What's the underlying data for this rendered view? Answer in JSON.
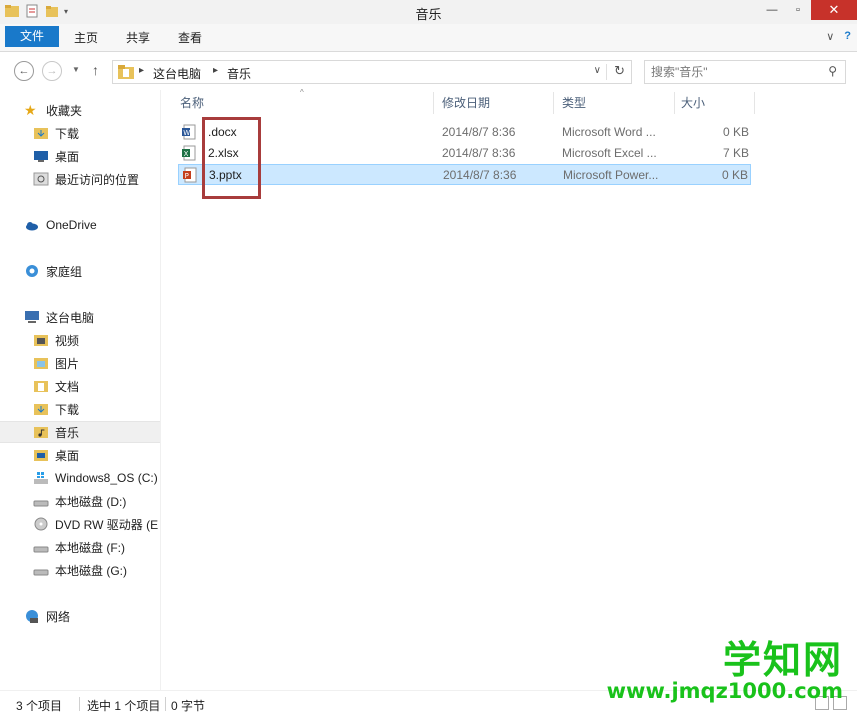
{
  "window": {
    "title": "音乐"
  },
  "ribbon": {
    "tabs": [
      "文件",
      "主页",
      "共享",
      "查看"
    ]
  },
  "address": {
    "crumbs": [
      "这台电脑",
      "音乐"
    ]
  },
  "search": {
    "placeholder": "搜索\"音乐\""
  },
  "sidebar": {
    "favorites_label": "收藏夹",
    "favorites": [
      "下载",
      "桌面",
      "最近访问的位置"
    ],
    "onedrive_label": "OneDrive",
    "homegroup_label": "家庭组",
    "thispc_label": "这台电脑",
    "thispc_items": [
      "视频",
      "图片",
      "文档",
      "下载",
      "音乐",
      "桌面",
      "Windows8_OS (C:)",
      "本地磁盘 (D:)",
      "DVD RW 驱动器 (E",
      "本地磁盘 (F:)",
      "本地磁盘 (G:)"
    ],
    "network_label": "网络",
    "selected_item": "音乐"
  },
  "columns": {
    "name": "名称",
    "date": "修改日期",
    "type": "类型",
    "size": "大小"
  },
  "files": [
    {
      "name": ".docx",
      "date": "2014/8/7 8:36",
      "type": "Microsoft Word ...",
      "size": "0 KB",
      "icon": "word-doc-icon",
      "selected": false
    },
    {
      "name": "2.xlsx",
      "date": "2014/8/7 8:36",
      "type": "Microsoft Excel ...",
      "size": "7 KB",
      "icon": "excel-doc-icon",
      "selected": false
    },
    {
      "name": "3.pptx",
      "date": "2014/8/7 8:36",
      "type": "Microsoft Power...",
      "size": "0 KB",
      "icon": "ppt-doc-icon",
      "selected": true
    }
  ],
  "status": {
    "count": "3 个项目",
    "selected": "选中 1 个项目",
    "size": "0 字节"
  },
  "watermark": {
    "text": "学知网",
    "url": "www.jmqz1000.com"
  },
  "colors": {
    "accent": "#1979ca",
    "selection": "#cce8ff",
    "highlight_box": "#a83c3c",
    "watermark": "#19c21b"
  }
}
